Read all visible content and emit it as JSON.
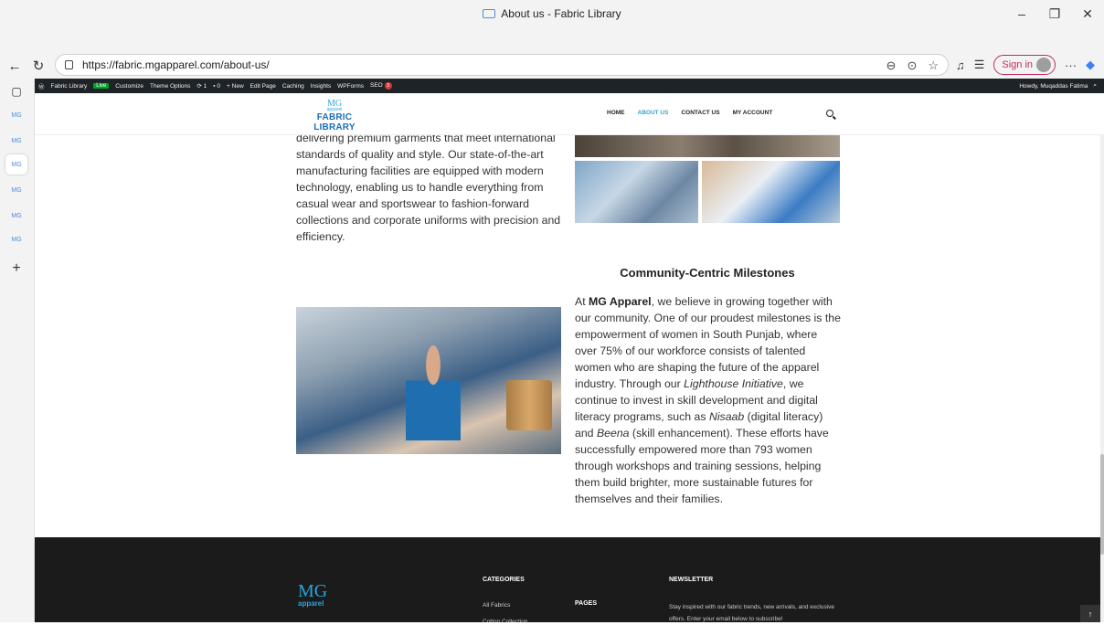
{
  "browser": {
    "tab_title": "About us - Fabric Library",
    "url": "https://fabric.mgapparel.com/about-us/",
    "sign_in": "Sign in",
    "sidebar_items": [
      "MG",
      "MG",
      "MG",
      "MG",
      "MG",
      "MG"
    ]
  },
  "wpbar": {
    "site": "Fabric Library",
    "live": "Live",
    "customize": "Customize",
    "theme_options": "Theme Options",
    "updates": "1",
    "comments": "0",
    "new": "New",
    "edit_page": "Edit Page",
    "caching": "Caching",
    "insights": "Insights",
    "wpforms": "WPForms",
    "seo": "SEO",
    "seo_count": "3",
    "howdy": "Howdy, Muqaddas Fatima"
  },
  "header": {
    "logo_mg": "MG",
    "logo_apparel": "apparel",
    "logo_title": "FABRIC LIBRARY",
    "nav": [
      "HOME",
      "ABOUT US",
      "CONTACT US",
      "MY ACCOUNT"
    ]
  },
  "content": {
    "left_paragraph": "delivering premium garments that meet international standards of quality and style. Our state-of-the-art manufacturing facilities are equipped with modern technology, enabling us to handle everything from casual wear and sportswear to fashion-forward collections and corporate uniforms with precision and efficiency.",
    "milestone_title": "Community-Centric Milestones",
    "p_at": "At ",
    "p_brand": "MG Apparel",
    "p_1": ", we believe in growing together with our community. One of our proudest milestones is the empowerment of women in South Punjab, where over 75% of our workforce consists of talented women who are shaping the future of the apparel industry. Through our ",
    "p_lighthouse": "Lighthouse Initiative",
    "p_2": ", we continue to invest in skill development and digital literacy programs, such as ",
    "p_nisaab": "Nisaab",
    "p_3": " (digital literacy) and ",
    "p_beena": "Beena",
    "p_4": " (skill enhancement). These efforts have successfully empowered more than 793 women through workshops and training sessions, helping them build brighter, more sustainable futures for themselves and their families."
  },
  "footer": {
    "logo_mg": "MG",
    "logo_apparel": "apparel",
    "categories_heading": "CATEGORIES",
    "category_links": [
      "All Fabrics",
      "Cotton Collection"
    ],
    "pages_heading": "PAGES",
    "newsletter_heading": "NEWSLETTER",
    "newsletter_text": "Stay inspired with our fabric trends, new arrivals, and exclusive offers. Enter your email below to subscribe!",
    "to_top": "↑"
  }
}
